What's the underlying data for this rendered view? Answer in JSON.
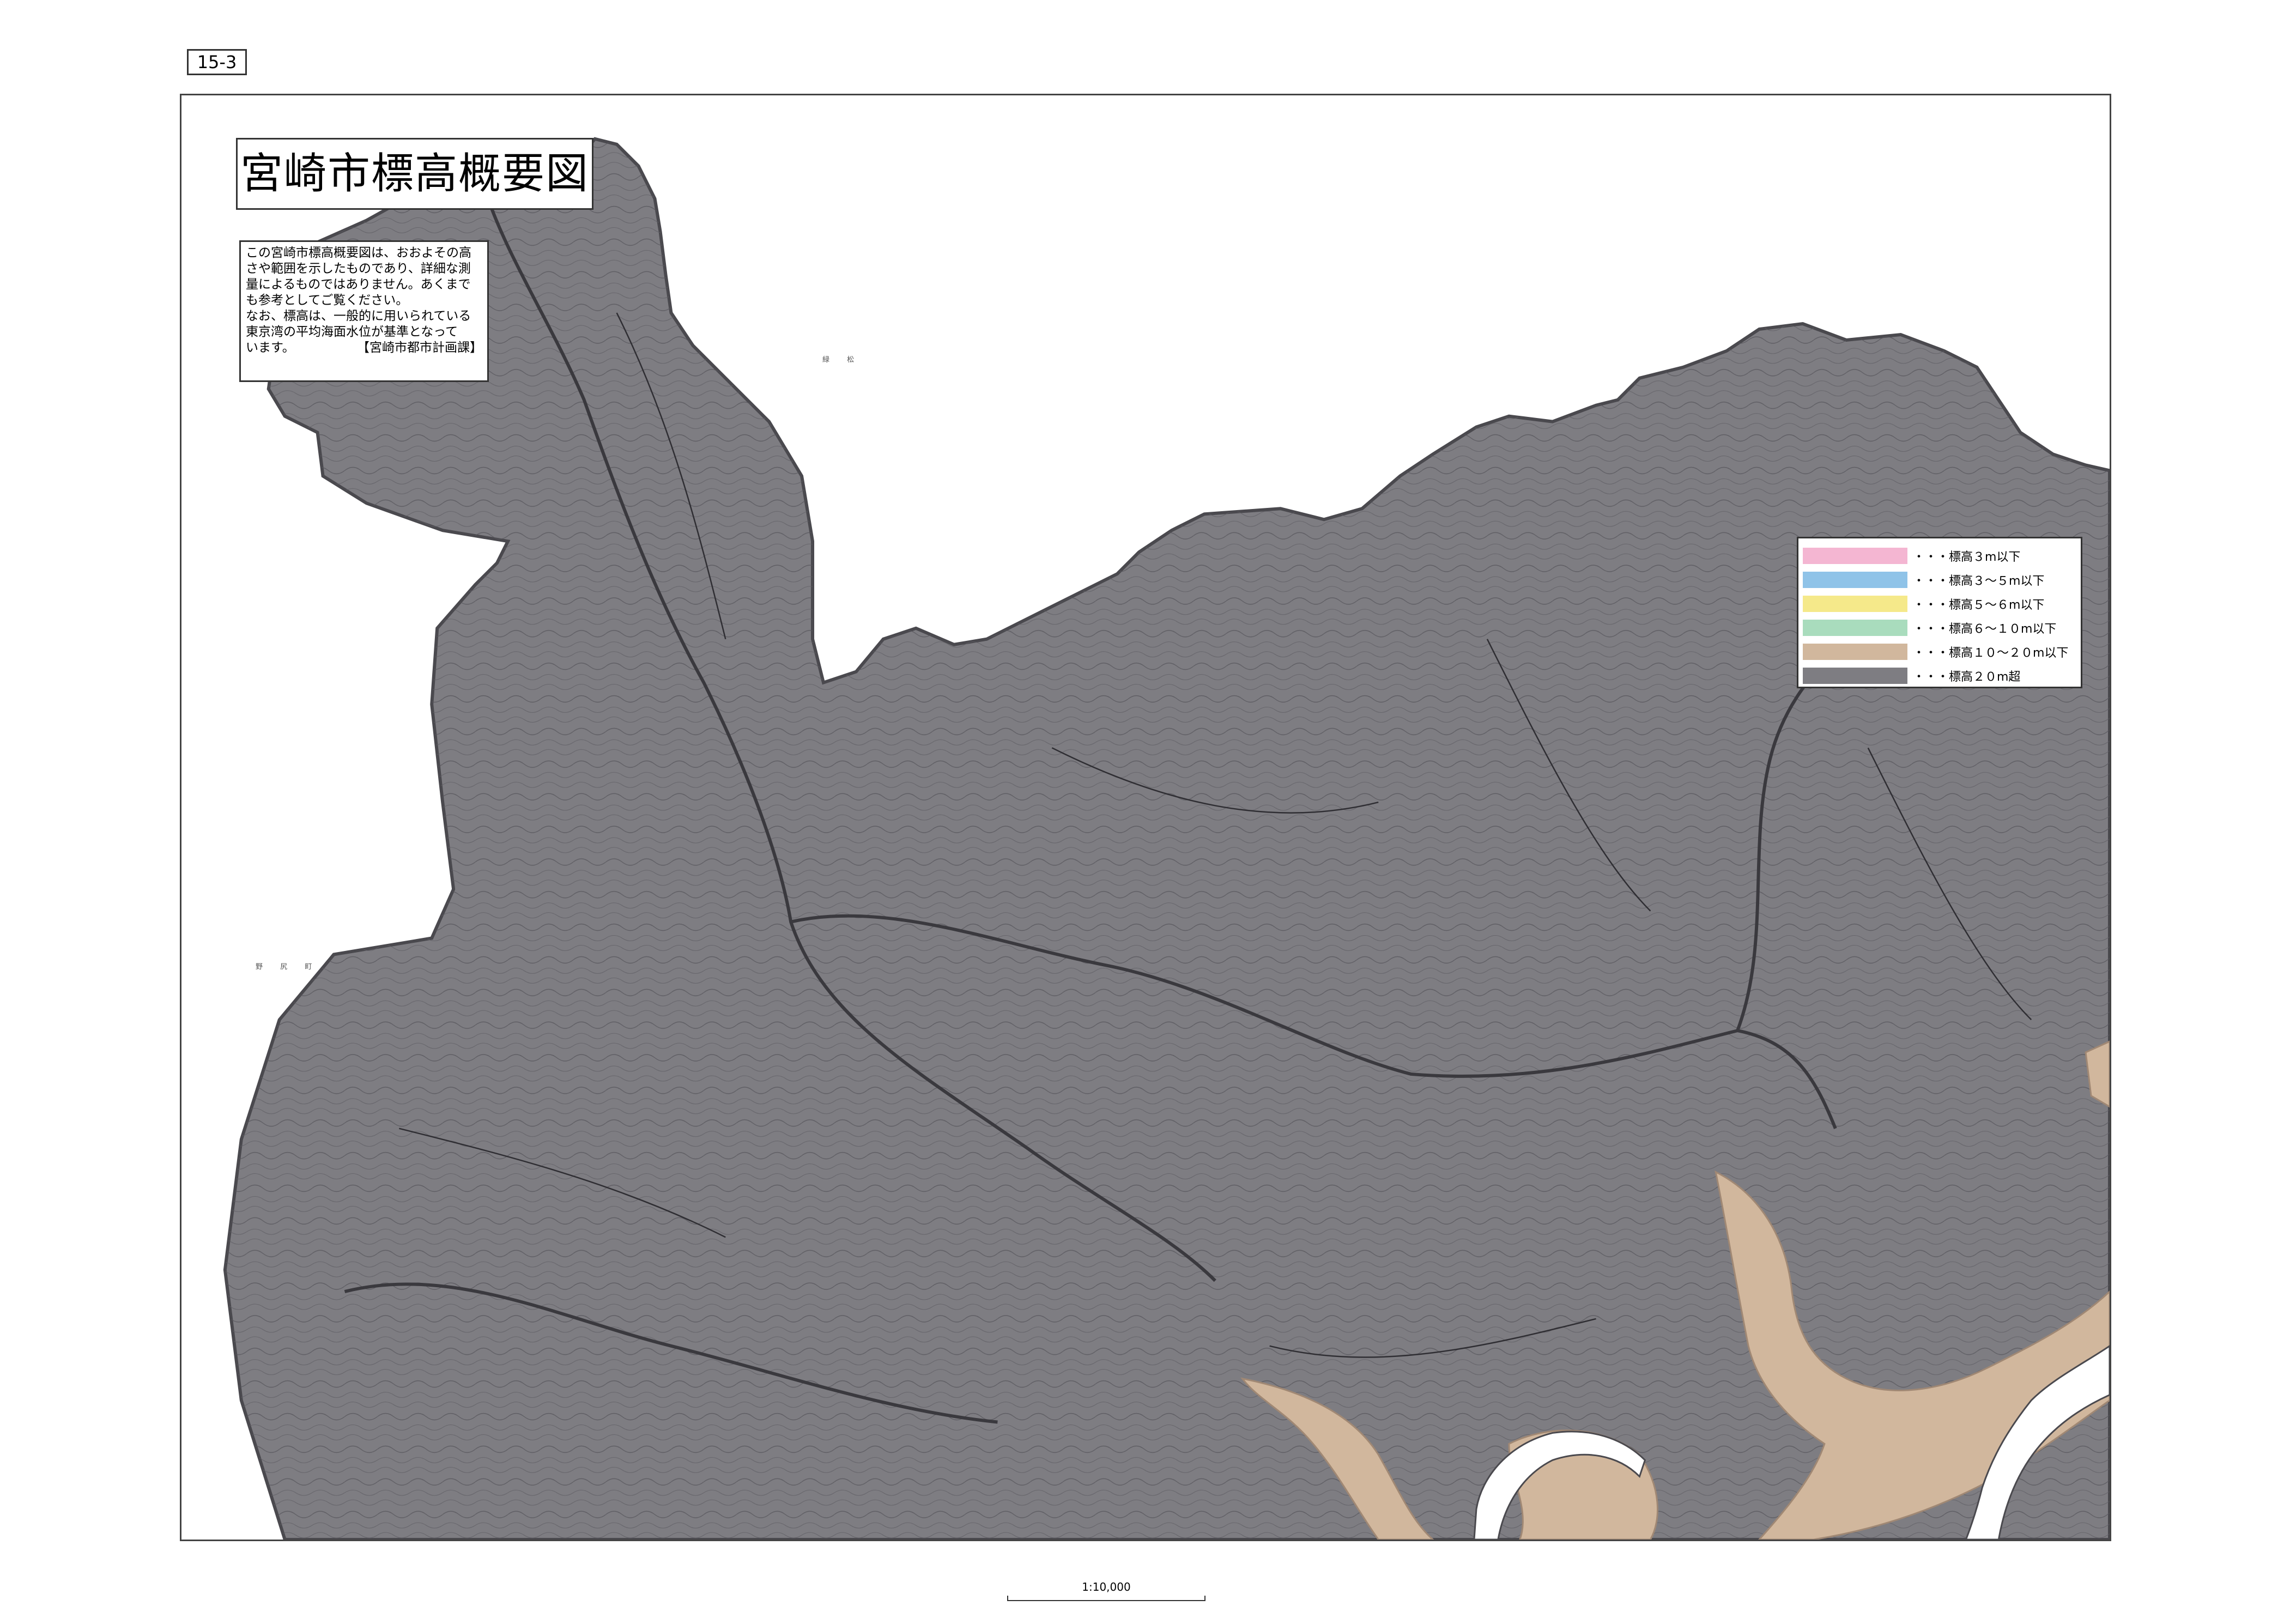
{
  "sheet_number": "15-3",
  "title": "宮崎市標高概要図",
  "note": {
    "lines": [
      "この宮崎市標高概要図は、おおよその高",
      "さや範囲を示したものであり、詳細な測",
      "量によるものではありません。あくまで",
      "も参考としてご覧ください。",
      "なお、標高は、一般的に用いられている",
      "東京湾の平均海面水位が基準となって",
      "います。"
    ],
    "credit": "【宮崎市都市計画課】"
  },
  "place_labels": {
    "north": "緑 松",
    "west": "野 尻 町"
  },
  "legend": {
    "items": [
      {
        "label": "・・・標高３m以下",
        "color": "#f4b6d2"
      },
      {
        "label": "・・・標高３～５m以下",
        "color": "#8fc3e8"
      },
      {
        "label": "・・・標高５～６m以下",
        "color": "#f5e98a"
      },
      {
        "label": "・・・標高６～１０m以下",
        "color": "#a9dcbd"
      },
      {
        "label": "・・・標高１０～２０m以下",
        "color": "#d1b79d"
      },
      {
        "label": "・・・標高２０m超",
        "color": "#7e7d82"
      }
    ]
  },
  "scale": {
    "ratio": "1:10,000"
  },
  "map_colors": {
    "over_20m": "#7e7d82",
    "elev_10_20m": "#d1b79d",
    "river": "#ffffff",
    "contour": "#55545a"
  }
}
